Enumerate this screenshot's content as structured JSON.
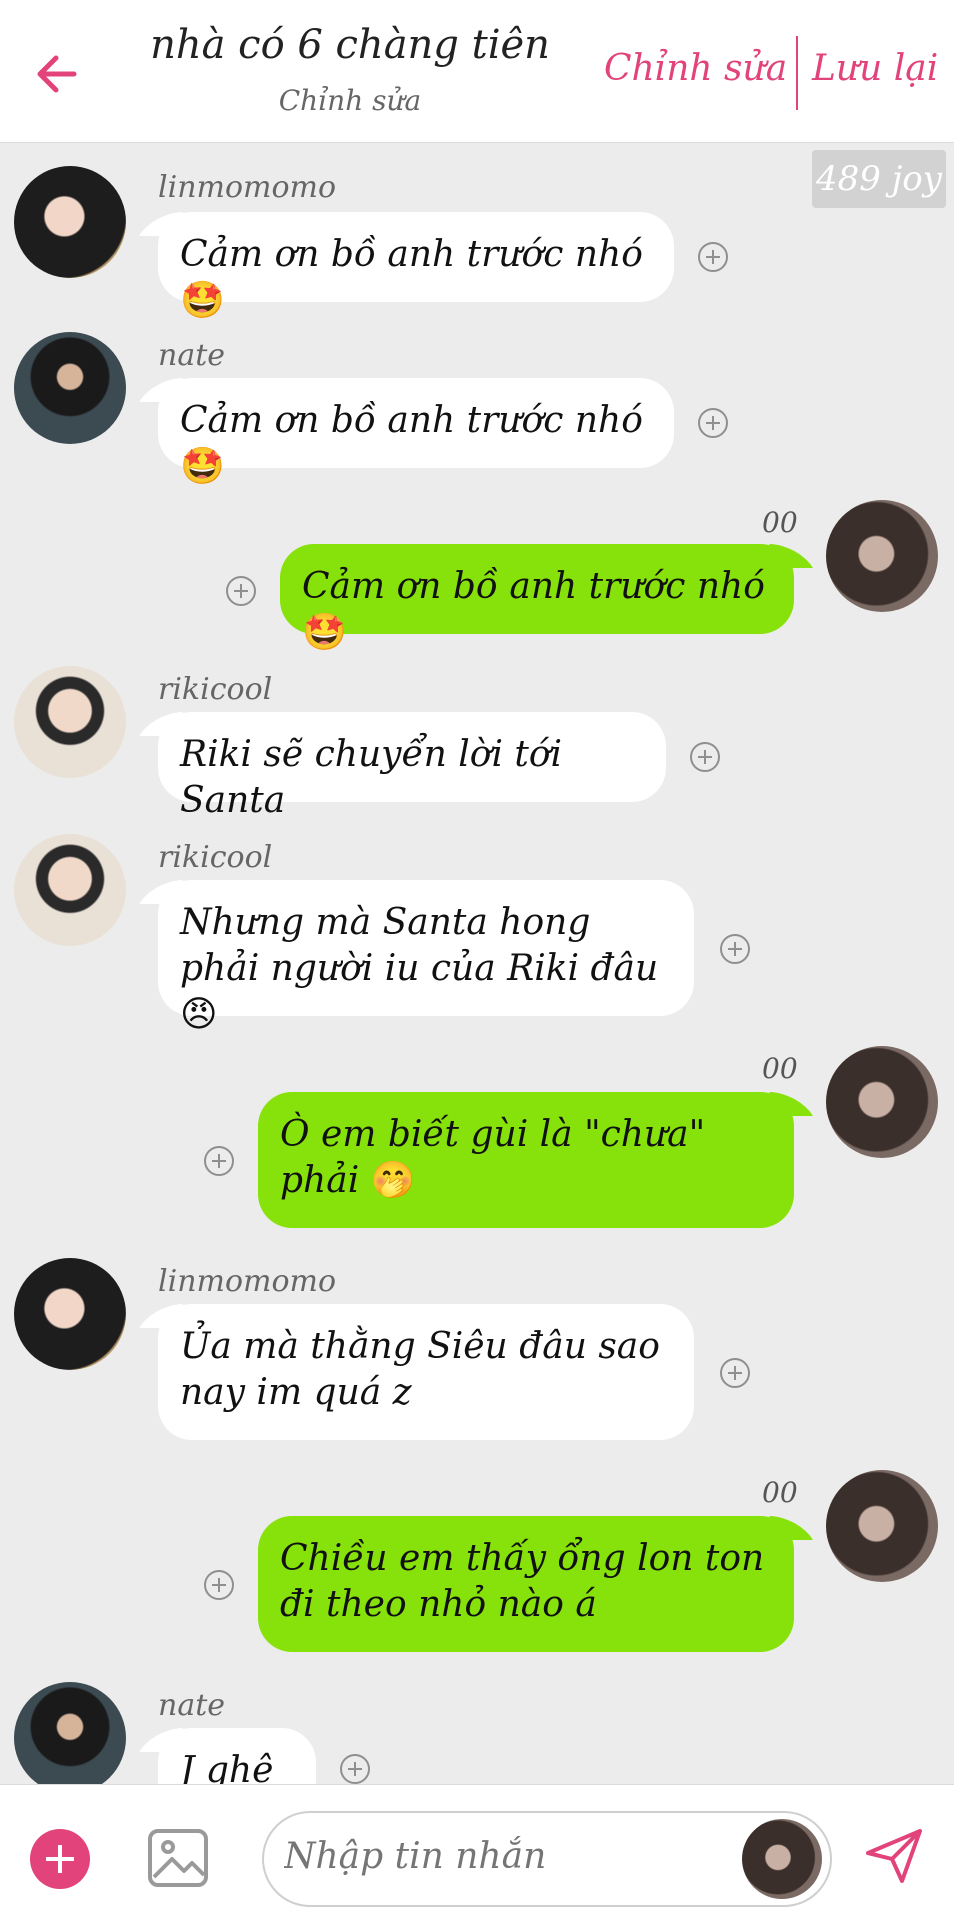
{
  "header": {
    "title": "nhà có 6 chàng tiên",
    "subtitle": "Chỉnh sửa",
    "edit_label": "Chỉnh sửa",
    "save_label": "Lưu lại"
  },
  "watermark": "489 joy",
  "colors": {
    "accent": "#e2437b",
    "outgoing_bubble": "#86e20a",
    "incoming_bubble": "#ffffff",
    "background": "#ececec"
  },
  "messages": [
    {
      "sender": "linmomomo",
      "direction": "in",
      "text": "Cảm ơn bồ anh trước nhó",
      "emoji": "🤩"
    },
    {
      "sender": "nate",
      "direction": "in",
      "text": "Cảm ơn bồ anh trước nhó",
      "emoji": "🤩"
    },
    {
      "sender": "00",
      "direction": "out",
      "text": "Cảm ơn bồ anh trước nhó",
      "emoji": "🤩"
    },
    {
      "sender": "rikicool",
      "direction": "in",
      "text": "Riki sẽ chuyển lời tới Santa",
      "emoji": ""
    },
    {
      "sender": "rikicool",
      "direction": "in",
      "text": "Nhưng mà Santa hong phải người iu của Riki đâu",
      "emoji": "😠"
    },
    {
      "sender": "00",
      "direction": "out",
      "text": "Ò em biết gùi là \"chưa\" phải",
      "emoji": "🤭"
    },
    {
      "sender": "linmomomo",
      "direction": "in",
      "text": "Ủa mà thằng Siêu đâu sao nay im quá z",
      "emoji": ""
    },
    {
      "sender": "00",
      "direction": "out",
      "text": "Chiều em thấy ổng lon ton đi theo nhỏ nào á",
      "emoji": ""
    },
    {
      "sender": "nate",
      "direction": "in",
      "text": "J ghê z",
      "emoji": ""
    }
  ],
  "composer": {
    "placeholder": "Nhập tin nhắn"
  },
  "icons": {
    "back": "arrow-left-icon",
    "add": "plus-icon",
    "image": "image-icon",
    "send": "send-icon",
    "message_action": "plus-circle-icon"
  }
}
